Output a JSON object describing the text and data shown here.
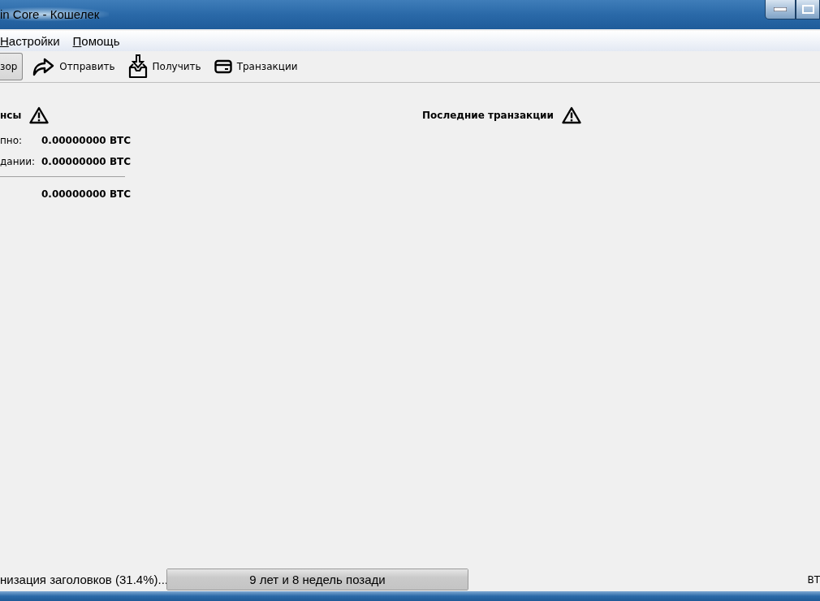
{
  "window": {
    "title": "in Core - Кошелек"
  },
  "menu": [
    {
      "label": "Настройки"
    },
    {
      "label": "Помощь"
    }
  ],
  "toolbar": [
    {
      "label": "зор",
      "kind": "overview",
      "selected": true
    },
    {
      "label": "Отправить",
      "kind": "send",
      "selected": false
    },
    {
      "label": "Получить",
      "kind": "receive",
      "selected": false
    },
    {
      "label": "Транзакции",
      "kind": "transactions",
      "selected": false
    }
  ],
  "balances": {
    "title": "нсы",
    "rows": [
      {
        "label": "пно:",
        "value": "0.00000000 BTC"
      },
      {
        "label": "дании:",
        "value": "0.00000000 BTC"
      }
    ],
    "total": "0.00000000 BTC"
  },
  "recent": {
    "title": "Последние транзакции"
  },
  "status_bar": {
    "sync_text": "низация заголовков (31.4%)...",
    "progress": {
      "text": "9 лет и 8 недель позади",
      "level": 1
    },
    "unit": "BT"
  }
}
